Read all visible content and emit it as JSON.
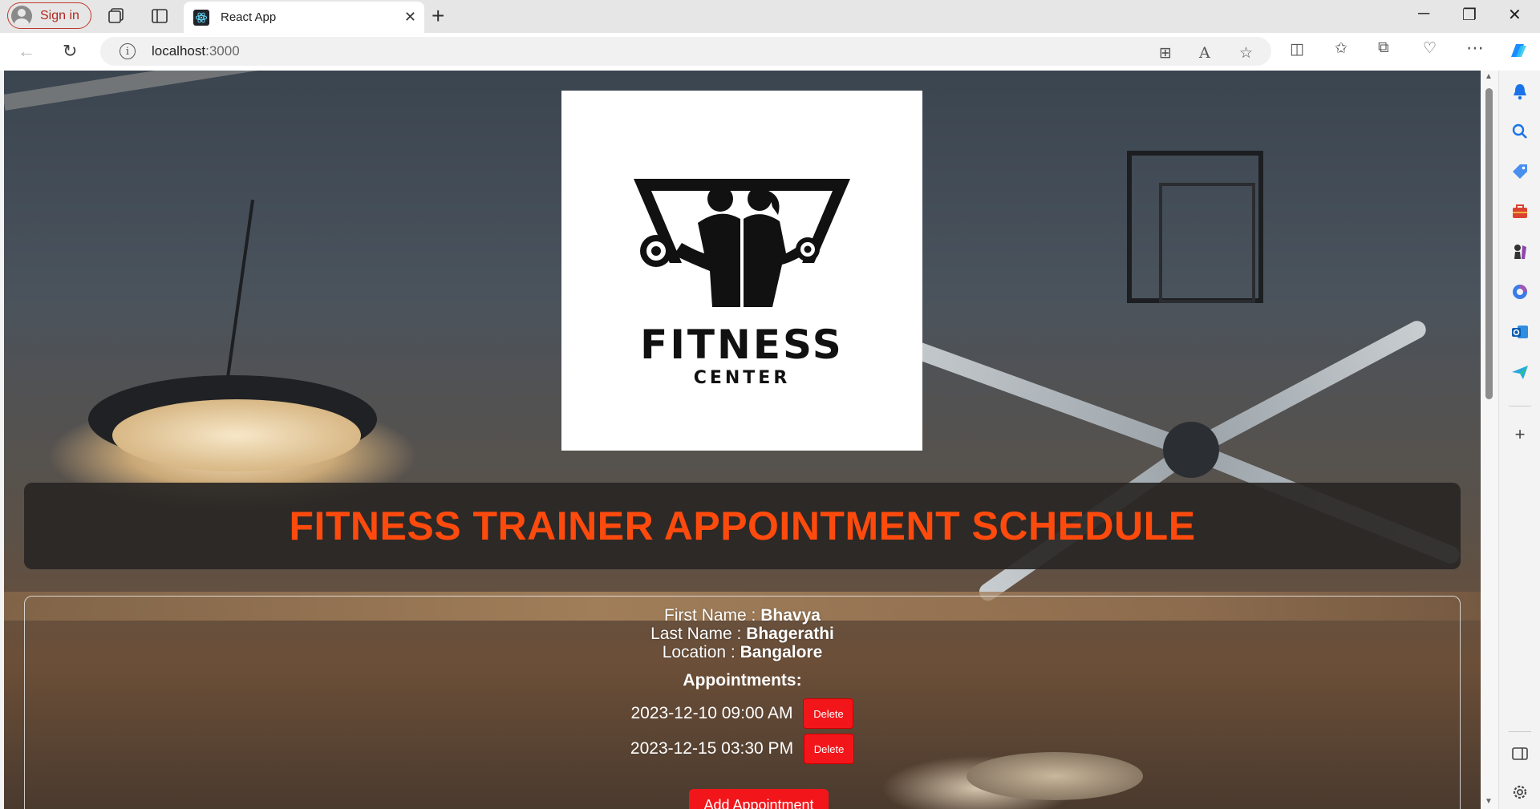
{
  "browser": {
    "sign_in_label": "Sign in",
    "tab_title": "React App",
    "new_tab_symbol": "+",
    "close_tab_symbol": "✕",
    "url_host": "localhost",
    "url_port": ":3000",
    "window_controls": {
      "minimize": "─",
      "restore": "❐",
      "close": "✕"
    }
  },
  "page": {
    "logo": {
      "line1": "FITNESS",
      "line2": "CENTER"
    },
    "heading": "FITNESS TRAINER APPOINTMENT SCHEDULE",
    "heading_color": "#ff4a0d",
    "trainer": {
      "first_name_label": "First Name : ",
      "first_name": "Bhavya",
      "last_name_label": "Last Name : ",
      "last_name": "Bhagerathi",
      "location_label": "Location : ",
      "location": "Bangalore"
    },
    "appointments_heading": "Appointments:",
    "appointments": [
      {
        "datetime": "2023-12-10 09:00 AM",
        "delete_label": "Delete"
      },
      {
        "datetime": "2023-12-15 03:30 PM",
        "delete_label": "Delete"
      }
    ],
    "add_button_label": "Add Appointment",
    "button_color": "#f2161b"
  },
  "sidebar_icons": [
    "bell-icon",
    "search-icon",
    "tag-icon",
    "briefcase-icon",
    "chess-icon",
    "copilot-icon",
    "outlook-icon",
    "send-icon",
    "add-icon",
    "sidebar-toggle-icon",
    "settings-icon"
  ]
}
